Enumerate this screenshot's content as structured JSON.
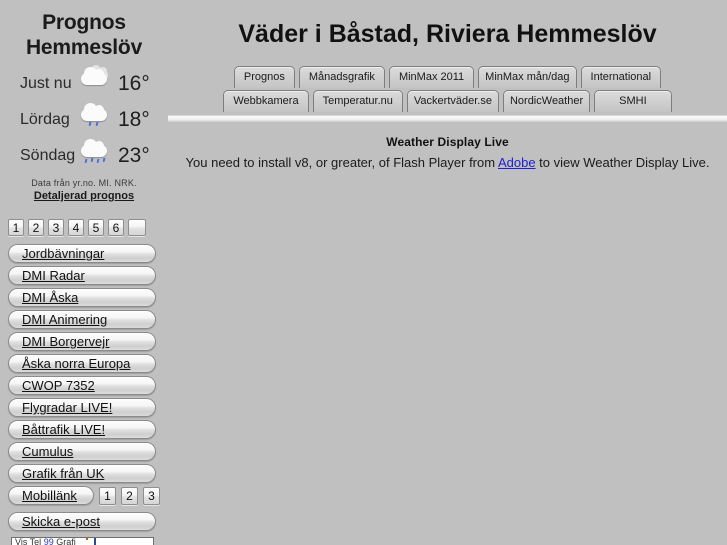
{
  "page": {
    "title": "Väder i Båstad, Riviera Hemmeslöv"
  },
  "sidebar": {
    "forecast": {
      "title_line1": "Prognos",
      "title_line2": "Hemmeslöv",
      "rows": [
        {
          "day": "Just nu",
          "icon": "cloudy-icon",
          "temp": "16°"
        },
        {
          "day": "Lördag",
          "icon": "rain-light-icon",
          "temp": "18°"
        },
        {
          "day": "Söndag",
          "icon": "rain-icon",
          "temp": "23°"
        }
      ],
      "credit": "Data från yr.no. MI. NRK.",
      "detail_link": "Detaljerad prognos"
    },
    "number_buttons": [
      "1",
      "2",
      "3",
      "4",
      "5",
      "6",
      ""
    ],
    "links": [
      "Jordbävningar",
      "DMI Radar",
      "DMI Åska",
      "DMI Animering",
      "DMI Borgervejr",
      "Åska norra Europa",
      "CWOP 7352",
      "Flygradar LIVE!",
      "Båttrafik LIVE!",
      "Cumulus",
      "Grafik från UK"
    ],
    "mobile": {
      "label": "Mobillänk",
      "numbers": [
        "1",
        "2",
        "3"
      ]
    },
    "email_button": "Skicka e-post",
    "bottom_strip": {
      "text_left": "Vis Tel",
      "text_mid": "99",
      "text_right": "Grafi"
    }
  },
  "tabs": {
    "row1": [
      "Prognos",
      "Månadsgrafik",
      "MinMax 2011",
      "MinMax mån/dag",
      "International"
    ],
    "row2": [
      "Webbkamera",
      "Temperatur.nu",
      "Vackertväder.se",
      "NordicWeather",
      "SMHI"
    ]
  },
  "content": {
    "wdl_title": "Weather Display Live",
    "msg_before": "You need to install v8, or greater, of Flash Player from ",
    "msg_link": "Adobe",
    "msg_after": " to view Weather Display Live."
  },
  "colors": {
    "background": "#c0c0c0",
    "link": "#2020d0",
    "text": "#111111",
    "raindrop": "#4a6fd8"
  }
}
